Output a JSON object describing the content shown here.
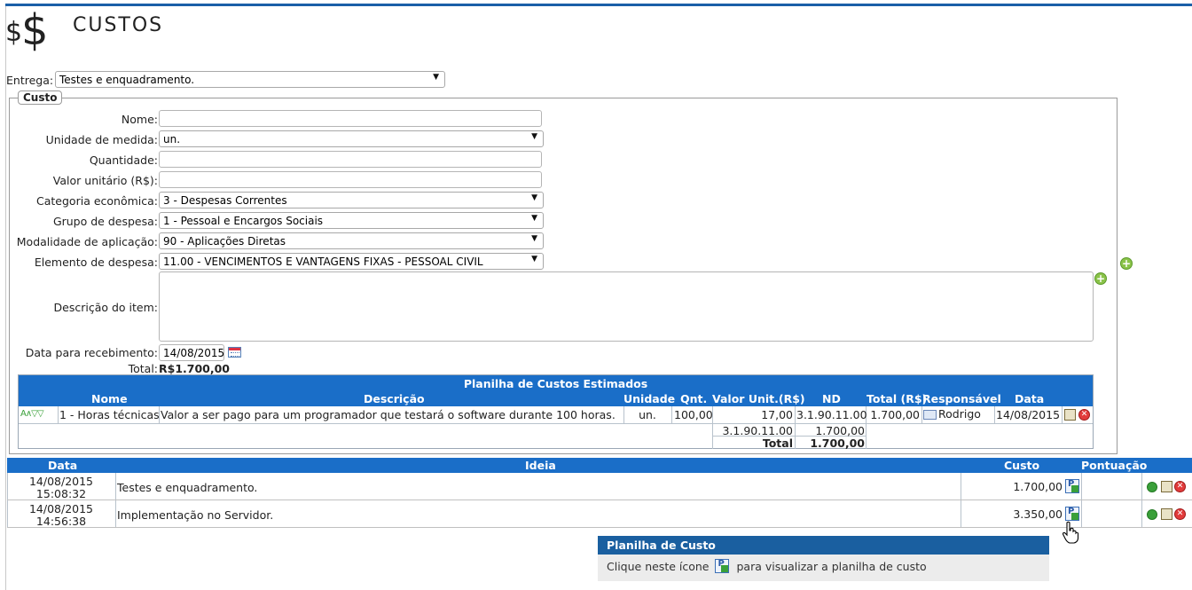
{
  "page": {
    "title": "CUSTOS"
  },
  "entrega": {
    "label": "Entrega:",
    "value": "Testes e enquadramento."
  },
  "form": {
    "legend": "Custo",
    "nome": {
      "label": "Nome:",
      "value": ""
    },
    "unidade": {
      "label": "Unidade de medida:",
      "value": "un."
    },
    "quantidade": {
      "label": "Quantidade:",
      "value": ""
    },
    "valor_unitario": {
      "label": "Valor unitário (R$):",
      "value": ""
    },
    "categoria": {
      "label": "Categoria econômica:",
      "value": "3 - Despesas Correntes"
    },
    "grupo": {
      "label": "Grupo de despesa:",
      "value": "1 - Pessoal e Encargos Sociais"
    },
    "modalidade": {
      "label": "Modalidade de aplicação:",
      "value": "90 - Aplicações Diretas"
    },
    "elemento": {
      "label": "Elemento de despesa:",
      "value": "11.00 - VENCIMENTOS E VANTAGENS FIXAS - PESSOAL CIVIL"
    },
    "descricao": {
      "label": "Descrição do item:",
      "value": ""
    },
    "data_recebimento": {
      "label": "Data para recebimento:",
      "value": "14/08/2015"
    },
    "total": {
      "label": "Total:",
      "value": "R$1.700,00"
    }
  },
  "planilha": {
    "title": "Planilha de Custos Estimados",
    "headers": [
      "Nome",
      "Descrição",
      "Unidade",
      "Qnt.",
      "Valor Unit.(R$)",
      "ND",
      "Total (R$)",
      "Responsável",
      "Data"
    ],
    "row": {
      "nome": "1 - Horas técnicas",
      "descricao": "Valor a ser pago para um programador que testará o software durante 100 horas.",
      "unidade": "un.",
      "qnt": "100,00",
      "valor_unit": "17,00",
      "nd": "3.1.90.11.00",
      "total": "1.700,00",
      "responsavel": "Rodrigo",
      "data": "14/08/2015"
    },
    "subtotal": {
      "nd": "3.1.90.11.00",
      "value": "1.700,00"
    },
    "total": {
      "label": "Total",
      "value": "1.700,00"
    }
  },
  "ideias": {
    "headers": {
      "data": "Data",
      "ideia": "Ideia",
      "custo": "Custo",
      "pontuacao": "Pontuação"
    },
    "rows": [
      {
        "date": "14/08/2015",
        "time": "15:08:32",
        "ideia": "Testes e enquadramento.",
        "custo": "1.700,00"
      },
      {
        "date": "14/08/2015",
        "time": "14:56:38",
        "ideia": "Implementação no Servidor.",
        "custo": "3.350,00"
      }
    ]
  },
  "tooltip": {
    "title": "Planilha de Custo",
    "text_before": "Clique neste ícone",
    "text_after": "para visualizar a planilha de custo"
  },
  "colors": {
    "header_blue": "#1a6ec8",
    "tooltip_blue": "#1a5fa0",
    "add_green": "#8bc34a"
  },
  "icons": [
    "dollar-icon",
    "calendar-icon",
    "add-icon",
    "sheet-icon",
    "edit-icon",
    "delete-icon",
    "envelope-icon",
    "hand-cursor"
  ]
}
